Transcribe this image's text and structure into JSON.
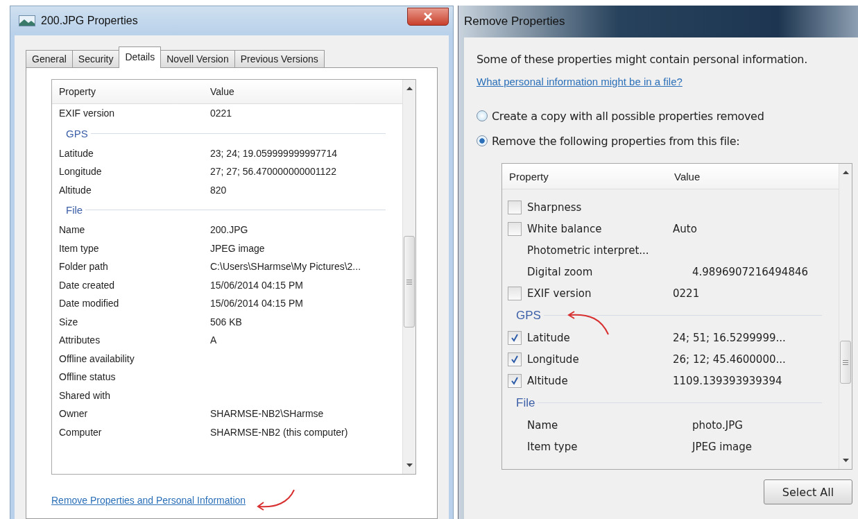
{
  "properties_window": {
    "title": "200.JPG Properties",
    "tabs": [
      {
        "label": "General",
        "selected": false
      },
      {
        "label": "Security",
        "selected": false
      },
      {
        "label": "Details",
        "selected": true
      },
      {
        "label": "Novell Version",
        "selected": false
      },
      {
        "label": "Previous Versions",
        "selected": false
      }
    ],
    "columns": [
      "Property",
      "Value"
    ],
    "items": [
      {
        "kind": "row",
        "property": "EXIF version",
        "value": "0221"
      },
      {
        "kind": "section",
        "label": "GPS"
      },
      {
        "kind": "row",
        "property": "Latitude",
        "value": "23; 24; 19.059999999997714"
      },
      {
        "kind": "row",
        "property": "Longitude",
        "value": "27; 27; 56.470000000001122"
      },
      {
        "kind": "row",
        "property": "Altitude",
        "value": "820"
      },
      {
        "kind": "section",
        "label": "File"
      },
      {
        "kind": "row",
        "property": "Name",
        "value": "200.JPG"
      },
      {
        "kind": "row",
        "property": "Item type",
        "value": "JPEG image"
      },
      {
        "kind": "row",
        "property": "Folder path",
        "value": "C:\\Users\\SHarmse\\My Pictures\\2..."
      },
      {
        "kind": "row",
        "property": "Date created",
        "value": "15/06/2014 04:15 PM"
      },
      {
        "kind": "row",
        "property": "Date modified",
        "value": "15/06/2014 04:15 PM"
      },
      {
        "kind": "row",
        "property": "Size",
        "value": "506 KB"
      },
      {
        "kind": "row",
        "property": "Attributes",
        "value": "A"
      },
      {
        "kind": "row",
        "property": "Offline availability"
      },
      {
        "kind": "row",
        "property": "Offline status"
      },
      {
        "kind": "row",
        "property": "Shared with"
      },
      {
        "kind": "row",
        "property": "Owner",
        "value": "SHARMSE-NB2\\SHarmse"
      },
      {
        "kind": "row",
        "property": "Computer",
        "value": "SHARMSE-NB2 (this computer)"
      }
    ],
    "link": "Remove Properties and Personal Information"
  },
  "remove_window": {
    "title": "Remove Properties",
    "intro": "Some of these properties might contain personal information.",
    "link": "What personal information might be in a file?",
    "options": [
      {
        "label": "Create a copy with all possible properties removed",
        "selected": false
      },
      {
        "label": "Remove the following properties from this file:",
        "selected": true
      }
    ],
    "columns": [
      "Property",
      "Value"
    ],
    "items": [
      {
        "kind": "check",
        "property": "Sharpness",
        "checked": false
      },
      {
        "kind": "check",
        "property": "White balance",
        "value": "Auto",
        "checked": false
      },
      {
        "kind": "plain",
        "property": "Photometric interpret..."
      },
      {
        "kind": "plain",
        "property": "Digital zoom",
        "value": "4.9896907216494846"
      },
      {
        "kind": "check",
        "property": "EXIF version",
        "value": "0221",
        "checked": false
      },
      {
        "kind": "section",
        "label": "GPS"
      },
      {
        "kind": "check",
        "property": "Latitude",
        "value": "24; 51; 16.5299999...",
        "checked": true
      },
      {
        "kind": "check",
        "property": "Longitude",
        "value": "26; 12; 45.4600000...",
        "checked": true
      },
      {
        "kind": "check",
        "property": "Altitude",
        "value": "1109.139393939394",
        "checked": true
      },
      {
        "kind": "section",
        "label": "File"
      },
      {
        "kind": "plain",
        "property": "Name",
        "value": "photo.JPG"
      },
      {
        "kind": "plain",
        "property": "Item type",
        "value": "JPEG image"
      }
    ],
    "button": "Select All"
  }
}
